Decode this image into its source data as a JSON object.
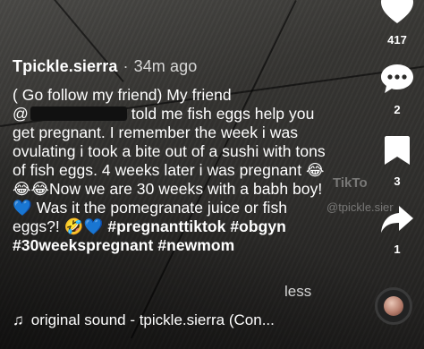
{
  "post": {
    "username": "Tpickle.sierra",
    "separator": "·",
    "time_ago": "34m ago",
    "caption_line1": "( Go follow my friend) My friend",
    "caption_at": "@",
    "caption_after_redact": " told me fish eggs help you get pregnant. I remember the week i was ovulating i took a bite out of a sushi with tons of fish eggs. 4 weeks later i was pregnant 😂😂😂Now we are 30 weeks with a babh boy! 💙 Was it the pomegranate juice or fish eggs?!",
    "caption_emojis_end": "🤣💙",
    "hashtags": [
      "#pregnanttiktok",
      "#obgyn",
      "#30weekspregnant",
      "#newmom"
    ],
    "less_label": "less"
  },
  "sound": {
    "note_icon": "music-note-icon",
    "label": "original sound - tpickle.sierra (Con..."
  },
  "rail": {
    "likes": "417",
    "comments": "2",
    "bookmarks": "3",
    "shares": "1"
  },
  "watermark": {
    "brand": "TikTo",
    "handle": "@tpickle.sier"
  }
}
